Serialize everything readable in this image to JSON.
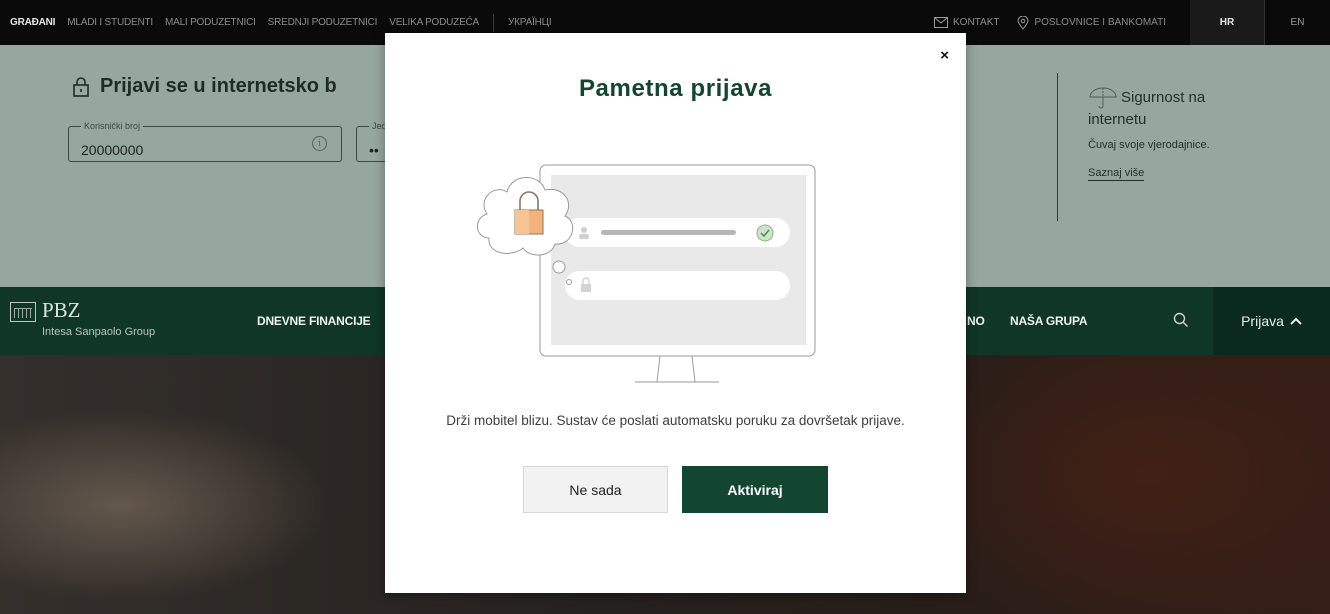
{
  "topbar": {
    "segments": [
      "GRAĐANI",
      "MLADI I STUDENTI",
      "MALI PODUZETNICI",
      "SREDNJI PODUZETNICI",
      "VELIKA PODUZEĆA"
    ],
    "ukrainian": "УКРАЇНЦІ",
    "contact": "KONTAKT",
    "branches": "POSLOVNICE I BANKOMATI",
    "lang_hr": "HR",
    "lang_en": "EN"
  },
  "login": {
    "title": "Prijavi se u internetsko b",
    "user_label": "Korisnički broj",
    "user_value": "20000000",
    "pass_label": "Jed",
    "pass_value": "••",
    "info_glyph": "i"
  },
  "security": {
    "heading": "Sigurnost na internetu",
    "text": "Čuvaj svoje vjerodajnice.",
    "link": "Saznaj više"
  },
  "nav": {
    "logo_name": "PBZ",
    "logo_group": "Intesa Sanpaolo Group",
    "item_daily": "DNEVNE FINANCIJE",
    "item_partial": "NO",
    "item_group": "NAŠA GRUPA",
    "login": "Prijava"
  },
  "modal": {
    "title": "Pametna prijava",
    "message": "Drži mobitel blizu. Sustav će poslati automatsku poruku za dovršetak prijave.",
    "btn_later": "Ne sada",
    "btn_activate": "Aktiviraj",
    "close": "×"
  },
  "colors": {
    "brand_green": "#124631",
    "nav_green": "#0f3627",
    "login_band": "#96a79f",
    "topbar": "#0a0a0a"
  },
  "icons": [
    "envelope-icon",
    "location-pin-icon",
    "lock-icon",
    "info-icon",
    "umbrella-icon",
    "search-icon",
    "chevron-up-icon",
    "close-icon",
    "padlock-illustration",
    "check-icon"
  ]
}
